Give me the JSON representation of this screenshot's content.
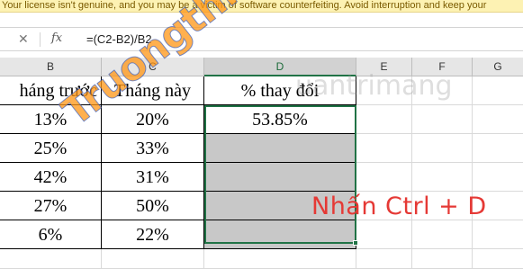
{
  "license_banner": "Your license isn't genuine, and you may be a victim of software counterfeiting. Avoid interruption and keep your",
  "formula_bar": {
    "cancel_icon": "x-icon",
    "fx_label": "fx",
    "formula": "=(C2-B2)/B2"
  },
  "columns": [
    "B",
    "C",
    "D",
    "E",
    "F",
    "G"
  ],
  "rows": {
    "headers": [
      "háng trước",
      "Tháng này",
      "% thay đổi"
    ],
    "data": [
      [
        "13%",
        "20%",
        "53.85%"
      ],
      [
        "25%",
        "33%",
        ""
      ],
      [
        "42%",
        "31%",
        ""
      ],
      [
        "27%",
        "50%",
        ""
      ],
      [
        "6%",
        "22%",
        ""
      ]
    ]
  },
  "annotation": "Nhấn Ctrl +  D",
  "watermarks": {
    "site1": "Truongthi.top",
    "site2": "uantrimang"
  },
  "colors": {
    "selection": "#217346",
    "fill": "#c8c8c8",
    "annotation": "#e53935",
    "banner": "#fdf2b3"
  }
}
